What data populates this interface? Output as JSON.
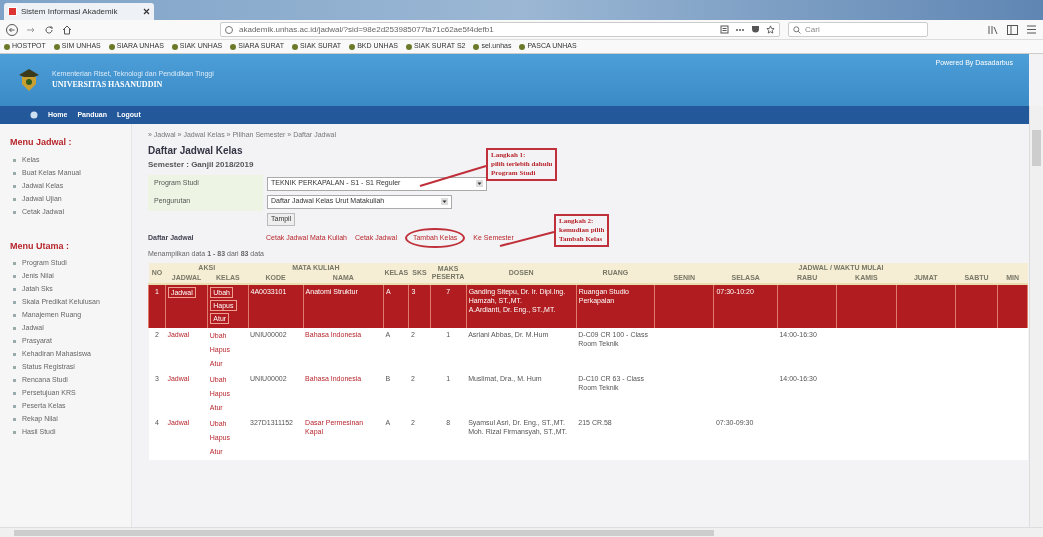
{
  "browser": {
    "tab_title": "Sistem Informasi Akademik",
    "url": "akademik.unhas.ac.id/jadwal/?sid=98e2d253985077ta71c62ae5f4defb1",
    "search_placeholder": "Cari",
    "bookmarks": [
      "HOSTPOT",
      "SIM UNHAS",
      "SIARA UNHAS",
      "SIAK UNHAS",
      "SIARA SURAT",
      "SIAK SURAT",
      "BKD UNHAS",
      "SIAK SURAT S2",
      "sel.unhas",
      "PASCA UNHAS"
    ]
  },
  "header": {
    "subtitle": "Kementerian Riset, Teknologi dan Pendidikan Tinggi",
    "title": "UNIVERSITAS HASANUDDIN",
    "powered_by": "Powered By Dasadarbus"
  },
  "nav": [
    "Home",
    "Panduan",
    "Logout"
  ],
  "sidebar": [
    {
      "title": "Menu Jadwal :",
      "items": [
        "Kelas",
        "Buat Kelas Manual",
        "Jadwal Kelas",
        "Jadwal Ujian",
        "Cetak Jadwal"
      ]
    },
    {
      "title": "Menu Utama :",
      "items": [
        "Program Studi",
        "Jenis Nilai",
        "Jatah Sks",
        "Skala Predikat Kelulusan",
        "Manajemen Ruang",
        "Jadwal",
        "Prasyarat",
        "Kehadiran Mahasiswa",
        "Status Registrasi",
        "Rencana Studi",
        "Persetujuan KRS",
        "Peserta Kelas",
        "Rekap Nilai",
        "Hasil Studi"
      ]
    }
  ],
  "main": {
    "breadcrumb": "» Jadwal » Jadwal Kelas » Pilihan Semester » Daftar Jadwal",
    "title": "Daftar Jadwal Kelas",
    "semester": "Semester : Ganjil 2018/2019",
    "fields": [
      {
        "label": "Program Studi",
        "value": "TEKNIK PERKAPALAN - S1 - S1 Reguler"
      },
      {
        "label": "Pengurutan",
        "value": "Daftar Jadwal Kelas Urut Matakuliah"
      }
    ],
    "submit": "Tampil",
    "list_title": "Daftar Jadwal",
    "links": [
      {
        "label": "Cetak Jadwal Mata Kuliah",
        "circled": false
      },
      {
        "label": "Cetak Jadwal",
        "circled": false
      },
      {
        "label": "Tambah Kelas",
        "circled": true
      },
      {
        "label": "Ke Semester",
        "circled": false
      }
    ],
    "info": "Menampilkan data **1 - 83** dari **83** data",
    "annotations": [
      "Langkah 1:\npilih terlebih dahulu\nProgram Studi",
      "Langkah 2:\nkemudian pilih\nTambah Kelas"
    ],
    "table": {
      "groups": [
        {
          "label": "NO"
        },
        {
          "label": "AKSI",
          "sub": [
            "JADWAL",
            "KELAS"
          ]
        },
        {
          "label": "MATA KULIAH",
          "sub": [
            "KODE",
            "NAMA"
          ]
        },
        {
          "label": "KELAS"
        },
        {
          "label": "SKS"
        },
        {
          "label": "MAKS PESERTA"
        },
        {
          "label": "DOSEN"
        },
        {
          "label": "RUANG"
        },
        {
          "label": "JADWAL / WAKTU MULAI",
          "sub": [
            "SENIN",
            "SELASA",
            "RABU",
            "KAMIS",
            "JUMAT",
            "SABTU",
            "MIN"
          ]
        }
      ],
      "rows": [
        {
          "no": "1",
          "selected": true,
          "jadwal": "Jadwal",
          "aksi": [
            "Ubah",
            "Hapus",
            "Atur"
          ],
          "kode": "4A0033101",
          "nama": "Anatomi Struktur",
          "kelas": "A",
          "sks": "3",
          "peserta": "7",
          "dosen": [
            "Ganding Sitepu, Dr. Ir. Dipl.Ing.",
            "Hamzah, ST.,MT.",
            "A.Ardianti, Dr. Eng., ST.,MT."
          ],
          "ruang": "Ruangan Studio Perkapalan",
          "schedule": {
            "selasa": "07:30-10:20"
          }
        },
        {
          "no": "2",
          "selected": false,
          "jadwal": "Jadwal",
          "aksi": [
            "Ubah",
            "Hapus",
            "Atur"
          ],
          "kode": "UNIU00002",
          "nama": "Bahasa Indonesia",
          "kelas": "A",
          "sks": "2",
          "peserta": "1",
          "dosen": [
            "Asriani Abbas, Dr. M.Hum"
          ],
          "ruang": "D-C09 CR 100 - Class Room Teknik",
          "schedule": {
            "rabu": "14:00-16:30"
          }
        },
        {
          "no": "3",
          "selected": false,
          "jadwal": "Jadwal",
          "aksi": [
            "Ubah",
            "Hapus",
            "Atur"
          ],
          "kode": "UNIU00002",
          "nama": "Bahasa Indonesia",
          "kelas": "B",
          "sks": "2",
          "peserta": "1",
          "dosen": [
            "Muslimat, Dra., M. Hum"
          ],
          "ruang": "D-C10 CR 63 - Class Room Teknik",
          "schedule": {
            "rabu": "14:00-16:30"
          }
        },
        {
          "no": "4",
          "selected": false,
          "jadwal": "Jadwal",
          "aksi": [
            "Ubah",
            "Hapus",
            "Atur"
          ],
          "kode": "327D1311152",
          "nama": "Dasar Permesinan Kapal",
          "kelas": "A",
          "sks": "2",
          "peserta": "8",
          "dosen": [
            "Syamsul Asri, Dr. Eng., ST.,MT.",
            "Moh. Rizal Firmansyah, ST.,MT."
          ],
          "ruang": "215 CR.58",
          "schedule": {
            "selasa": "07:30-09:30"
          }
        }
      ]
    }
  }
}
